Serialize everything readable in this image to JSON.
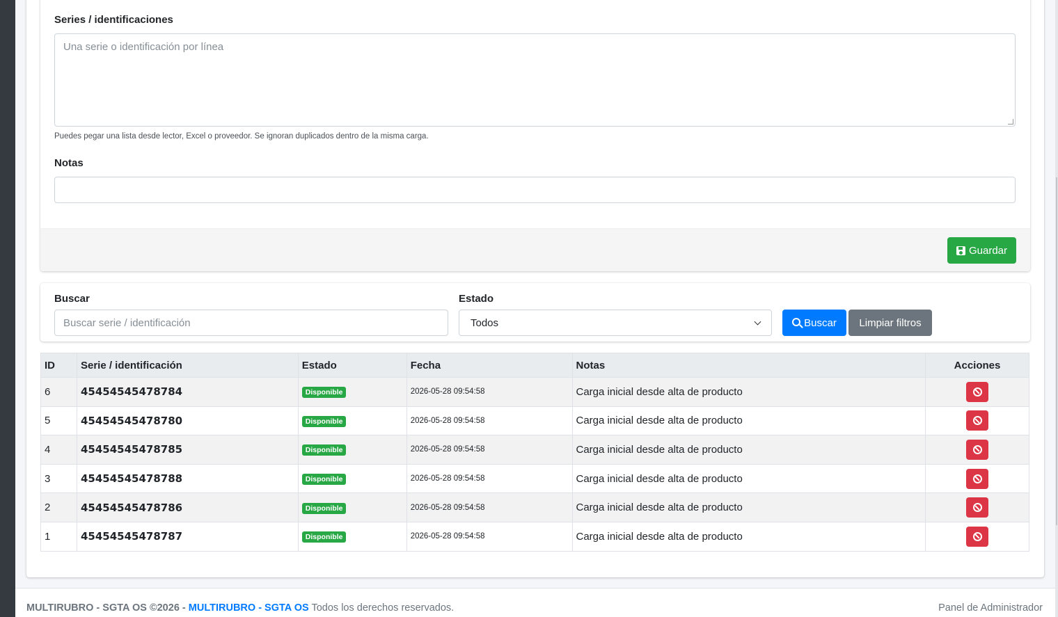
{
  "form": {
    "series_label": "Series / identificaciones",
    "series_placeholder": "Una serie o identificación por línea",
    "series_help": "Puedes pegar una lista desde lector, Excel o proveedor. Se ignoran duplicados dentro de la misma carga.",
    "notes_label": "Notas",
    "notes_value": "",
    "save_label": "Guardar"
  },
  "filters": {
    "search_label": "Buscar",
    "search_placeholder": "Buscar serie / identificación",
    "status_label": "Estado",
    "status_selected": "Todos",
    "search_button": "Buscar",
    "clear_button": "Limpiar filtros"
  },
  "table": {
    "headers": [
      "ID",
      "Serie / identificación",
      "Estado",
      "Fecha",
      "Notas",
      "Acciones"
    ],
    "rows": [
      {
        "id": "6",
        "serial": "45454545478784",
        "status": "Disponible",
        "date": "2026-05-28 09:54:58",
        "notes": "Carga inicial desde alta de producto"
      },
      {
        "id": "5",
        "serial": "45454545478780",
        "status": "Disponible",
        "date": "2026-05-28 09:54:58",
        "notes": "Carga inicial desde alta de producto"
      },
      {
        "id": "4",
        "serial": "45454545478785",
        "status": "Disponible",
        "date": "2026-05-28 09:54:58",
        "notes": "Carga inicial desde alta de producto"
      },
      {
        "id": "3",
        "serial": "45454545478788",
        "status": "Disponible",
        "date": "2026-05-28 09:54:58",
        "notes": "Carga inicial desde alta de producto"
      },
      {
        "id": "2",
        "serial": "45454545478786",
        "status": "Disponible",
        "date": "2026-05-28 09:54:58",
        "notes": "Carga inicial desde alta de producto"
      },
      {
        "id": "1",
        "serial": "45454545478787",
        "status": "Disponible",
        "date": "2026-05-28 09:54:58",
        "notes": "Carga inicial desde alta de producto"
      }
    ]
  },
  "footer": {
    "brand": "MULTIRUBRO - SGTA OS ©2026 -",
    "link": "MULTIRUBRO - SGTA OS",
    "rights": "Todos los derechos reservados.",
    "panel": "Panel de Administrador"
  },
  "colors": {
    "success": "#28a745",
    "primary": "#007bff",
    "danger": "#dc3545",
    "secondary": "#6c757d"
  },
  "icons": {
    "save": "save-icon",
    "search": "search-icon",
    "action": "ban-icon"
  }
}
